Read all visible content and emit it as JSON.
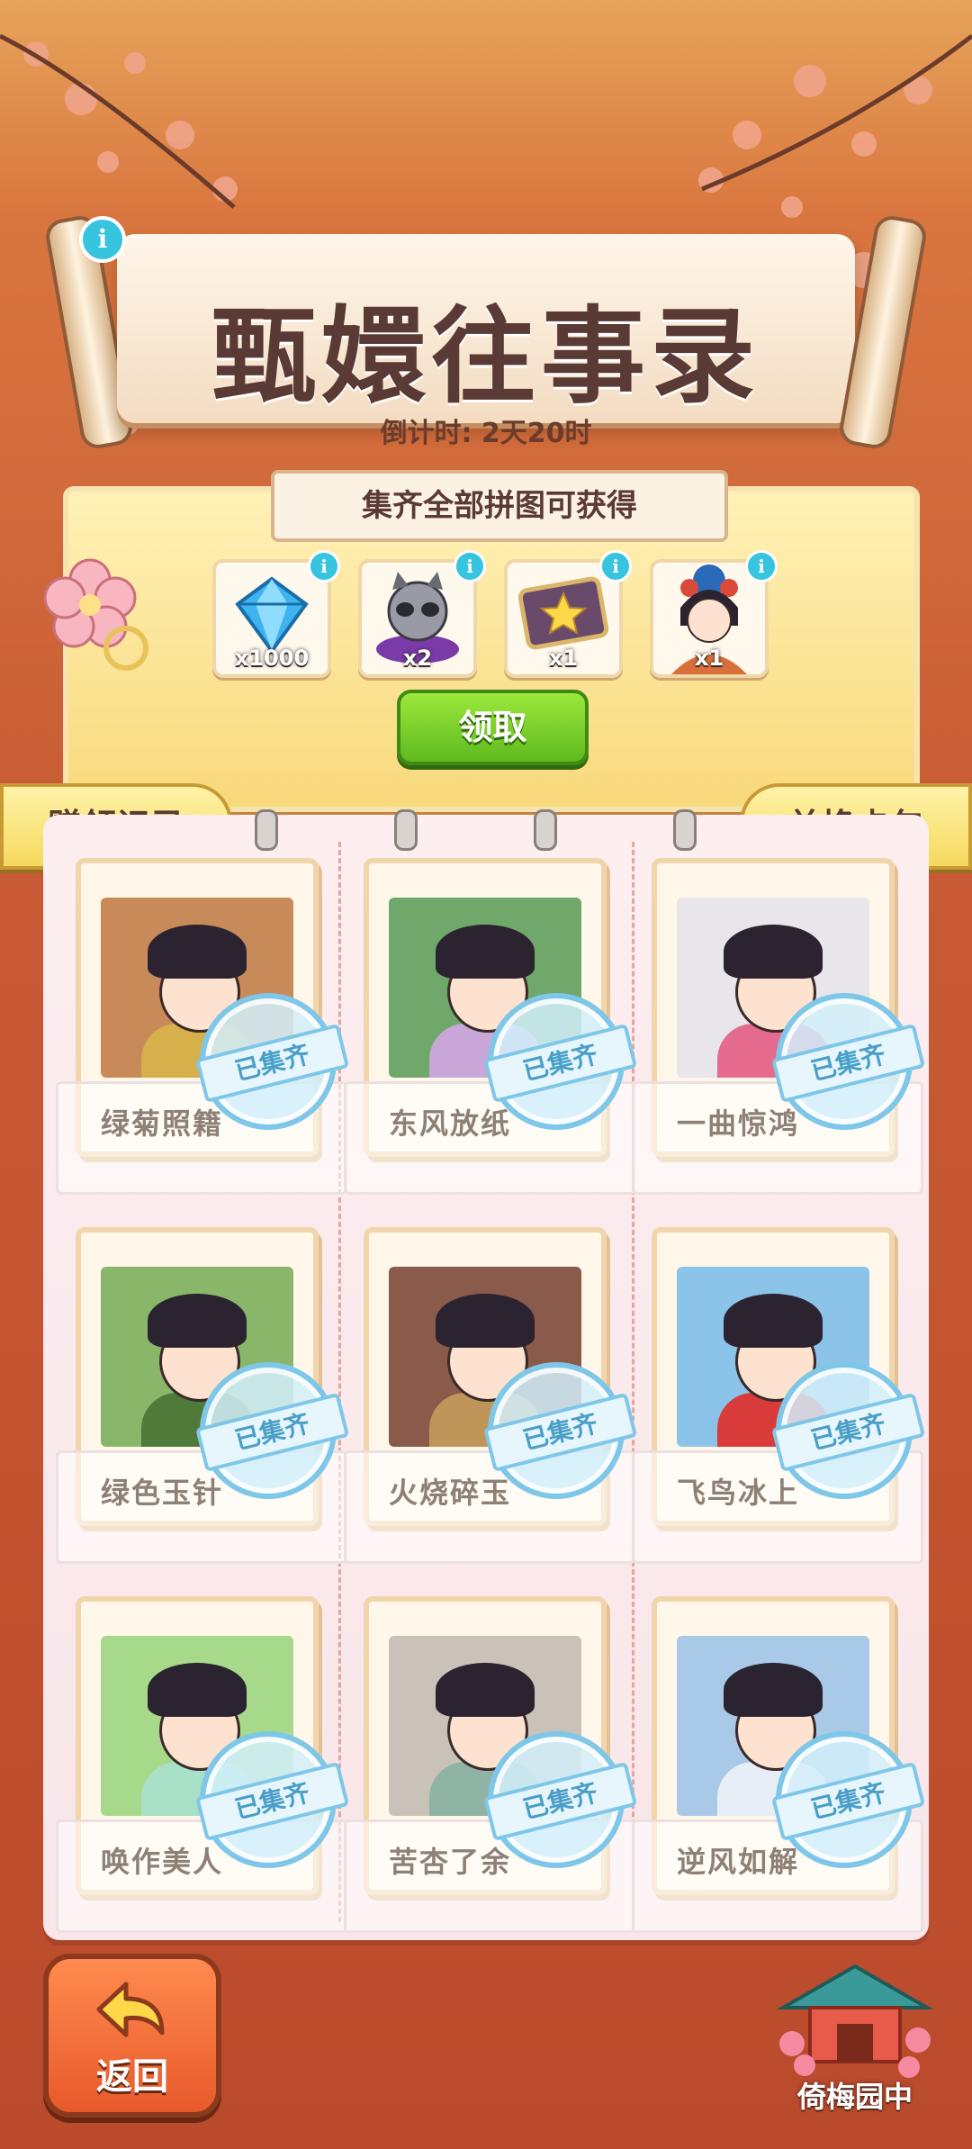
{
  "header": {
    "title": "甄嬛往事录",
    "countdown": "倒计时: 2天20时"
  },
  "reward": {
    "banner": "集齐全部拼图可获得",
    "items": [
      {
        "icon": "diamond-icon",
        "qty": "x1000"
      },
      {
        "icon": "raccoon-pet-icon",
        "qty": "x2"
      },
      {
        "icon": "star-card-icon",
        "qty": "x1"
      },
      {
        "icon": "consort-avatar-icon",
        "qty": "x1"
      }
    ],
    "claim_label": "领取"
  },
  "tabs": {
    "left_label": "赠领记录",
    "right_label": "兑换卡包"
  },
  "stamp_label": "已集齐",
  "cards": [
    {
      "name": "绿菊照籍",
      "bg": "#c98a5a",
      "dress": "#d6b04a"
    },
    {
      "name": "东风放纸",
      "bg": "#6fa86a",
      "dress": "#c9a7d9"
    },
    {
      "name": "一曲惊鸿",
      "bg": "#e8e6ea",
      "dress": "#e56b8e"
    },
    {
      "name": "绿色玉针",
      "bg": "#8ab66a",
      "dress": "#4f7a3a"
    },
    {
      "name": "火烧碎玉",
      "bg": "#8a5a4a",
      "dress": "#c0955a"
    },
    {
      "name": "飞鸟冰上",
      "bg": "#8bc4e8",
      "dress": "#d93a3a"
    },
    {
      "name": "唤作美人",
      "bg": "#a7d98a",
      "dress": "#a8e0c8"
    },
    {
      "name": "苦杏了余",
      "bg": "#c9c2b8",
      "dress": "#8fb3a4"
    },
    {
      "name": "逆风如解",
      "bg": "#a9c9e8",
      "dress": "#e8eef5"
    }
  ],
  "footer": {
    "back_label": "返回",
    "garden_label": "倚梅园中"
  }
}
